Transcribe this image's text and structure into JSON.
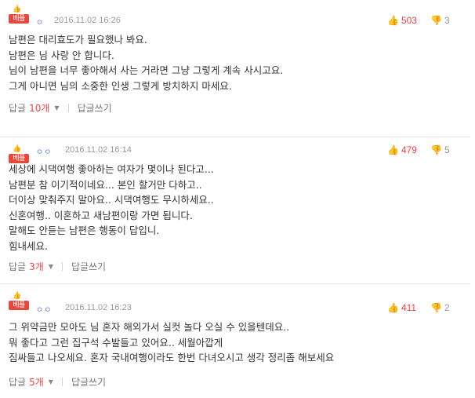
{
  "icons": {
    "like": "thumbs-up-icon",
    "dislike": "thumbs-down-icon",
    "best": "thumbs-up-badge-icon",
    "caret": "caret-down-icon"
  },
  "colors": {
    "accent": "#e64545",
    "author": "#6f83c8",
    "muted": "#9a9a9a"
  },
  "comments": [
    {
      "badge": "베플",
      "author": "ㅇ",
      "date": "2016.11.02 16:26",
      "likes": "503",
      "dislikes": "3",
      "lines": [
        "남편은 대리효도가 필요했나 봐요.",
        "남편은 님 사랑 안 합니다.",
        "님이 남편을 너무 좋아해서 사는 거라면 그냥 그렇게 계속 사시고요.",
        "그게 아니면 님의 소중한 인생 그렇게 방치하지 마세요."
      ],
      "reply_label": "답글",
      "reply_count": "10개",
      "write_reply": "답글쓰기"
    },
    {
      "badge": "베플",
      "author": "ㅇㅇ",
      "date": "2016.11.02 16:14",
      "likes": "479",
      "dislikes": "5",
      "lines": [
        "세상에 시댁여행 좋아하는 여자가 몇이나 된다고...",
        "남편분 참 이기적이네요... 본인 할거만 다하고..",
        "더이상 맞춰주지 말아요.. 시댁여행도 무시하세요..",
        "신혼여행.. 이혼하고 새남편이랑 가면 됩니다.",
        "말해도 안듣는 남편은 행동이 답입니.",
        "힘내세요."
      ],
      "reply_label": "답글",
      "reply_count": "3개",
      "write_reply": "답글쓰기"
    },
    {
      "badge": "베플",
      "author": "ㅇㅇ",
      "date": "2016.11.02 16:23",
      "likes": "411",
      "dislikes": "2",
      "lines": [
        "그 위약금만 모아도 님 혼자 해외가서 실컷 놀다 오실 수 있을텐데요..",
        "뭐 좋다고 그런 집구석 수발들고 있어요.. 세월아깝게",
        "짐싸들고 나오세요. 혼자 국내여행이라도 한번 다녀오시고 생각 정리좀 해보세요"
      ],
      "reply_label": "답글",
      "reply_count": "5개",
      "write_reply": "답글쓰기"
    }
  ]
}
